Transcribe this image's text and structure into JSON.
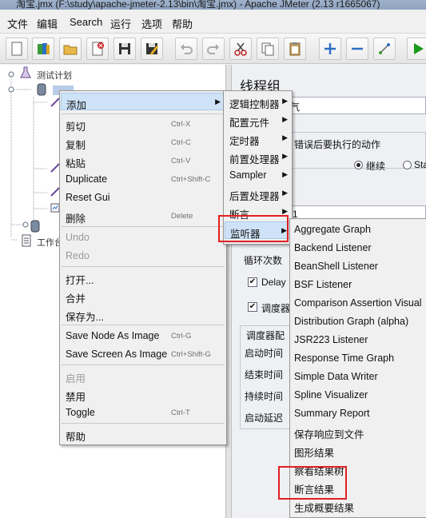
{
  "window": {
    "title": "淘宝.jmx (F:\\study\\apache-jmeter-2.13\\bin\\淘宝.jmx) - Apache JMeter (2.13 r1665067)"
  },
  "menubar": {
    "items": [
      "文件",
      "编辑",
      "Search",
      "运行",
      "选项",
      "帮助"
    ]
  },
  "toolbar": {
    "icons": [
      "new-icon",
      "templates-icon",
      "open-icon",
      "close-icon",
      "save-icon",
      "save-as-icon",
      "undo-icon",
      "redo-icon",
      "cut-icon",
      "copy-icon",
      "paste-icon",
      "expand-icon",
      "collapse-icon",
      "toggle-icon",
      "start-icon"
    ]
  },
  "tree": {
    "nodes": [
      "测试计划",
      "工作台"
    ]
  },
  "right_panel": {
    "title": "线程组",
    "fragments": {
      "name_suffix": "气",
      "error_action": "错误后要执行的动作",
      "continue": "继续",
      "start_next": "Sta",
      "thread_count": "1",
      "loop_count": "循环次数",
      "delay": "Delay",
      "scheduler": "调度器",
      "scheduler_config": "调度器配",
      "start_time": "启动时间",
      "end_time": "结束时间",
      "duration": "持续时间",
      "startup_delay": "启动延迟"
    }
  },
  "context_menu": {
    "add": "添加",
    "cut": {
      "label": "剪切",
      "shortcut": "Ctrl-X"
    },
    "copy": {
      "label": "复制",
      "shortcut": "Ctrl-C"
    },
    "paste": {
      "label": "粘贴",
      "shortcut": "Ctrl-V"
    },
    "duplicate": {
      "label": "Duplicate",
      "shortcut": "Ctrl+Shift-C"
    },
    "reset_gui": "Reset Gui",
    "delete": {
      "label": "删除",
      "shortcut": "Delete"
    },
    "undo": "Undo",
    "redo": "Redo",
    "open": "打开...",
    "merge": "合并",
    "save_as": "保存为...",
    "save_node_image": {
      "label": "Save Node As Image",
      "shortcut": "Ctrl-G"
    },
    "save_screen_image": {
      "label": "Save Screen As Image",
      "shortcut": "Ctrl+Shift-G"
    },
    "enable": "启用",
    "disable": "禁用",
    "toggle": {
      "label": "Toggle",
      "shortcut": "Ctrl-T"
    },
    "help": "帮助"
  },
  "submenu_add": {
    "items": [
      "逻辑控制器",
      "配置元件",
      "定时器",
      "前置处理器",
      "Sampler",
      "后置处理器",
      "断言",
      "监听器"
    ],
    "highlighted": "监听器"
  },
  "submenu_listeners": {
    "items": [
      "Aggregate Graph",
      "Backend Listener",
      "BeanShell Listener",
      "BSF Listener",
      "Comparison Assertion Visual",
      "Distribution Graph (alpha)",
      "JSR223 Listener",
      "Response Time Graph",
      "Simple Data Writer",
      "Spline Visualizer",
      "Summary Report",
      "保存响应到文件",
      "图形结果",
      "察看结果树",
      "断言结果",
      "生成概要结果"
    ]
  },
  "colors": {
    "highlight": "#cfe3f8",
    "annotation_red": "#e02020",
    "start_green": "#1a9a1a"
  }
}
